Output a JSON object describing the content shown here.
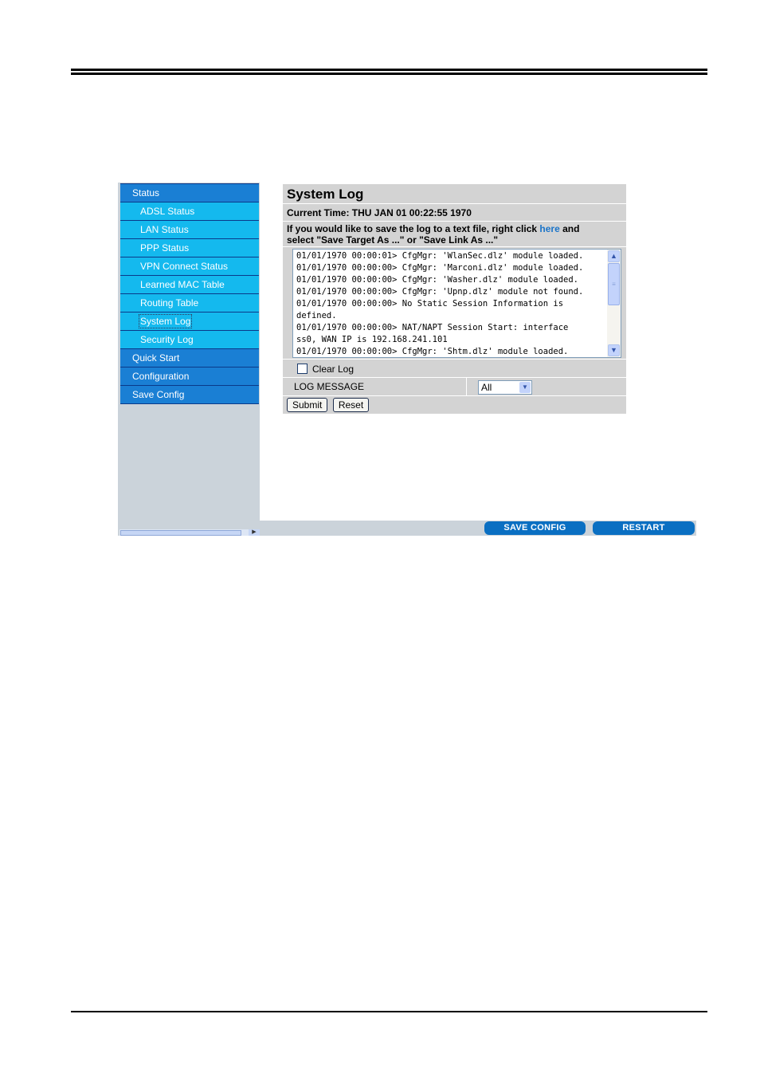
{
  "sidebar": {
    "items": [
      {
        "label": "Status",
        "level": "top"
      },
      {
        "label": "ADSL Status",
        "level": "sub"
      },
      {
        "label": "LAN Status",
        "level": "sub"
      },
      {
        "label": "PPP Status",
        "level": "sub"
      },
      {
        "label": "VPN Connect Status",
        "level": "sub"
      },
      {
        "label": "Learned MAC Table",
        "level": "sub"
      },
      {
        "label": "Routing Table",
        "level": "sub"
      },
      {
        "label": "System Log",
        "level": "sub",
        "selected": true
      },
      {
        "label": "Security Log",
        "level": "sub"
      },
      {
        "label": "Quick Start",
        "level": "top"
      },
      {
        "label": "Configuration",
        "level": "top"
      },
      {
        "label": "Save Config",
        "level": "top"
      }
    ],
    "scroll_arrow_icon": "scroll-right-icon"
  },
  "main": {
    "title": "System Log",
    "current_time": "Current Time: THU JAN 01 00:22:55 1970",
    "note_before": "If you would like to save the log to a text file, right click ",
    "note_link": "here",
    "note_after": " and",
    "note_line2": "select \"Save Target As ...\" or \"Save Link As ...\"",
    "log_lines": [
      "01/01/1970 00:00:01> CfgMgr: 'WlanSec.dlz' module loaded.",
      "01/01/1970 00:00:00> CfgMgr: 'Marconi.dlz' module loaded.",
      "01/01/1970 00:00:00> CfgMgr: 'Washer.dlz' module loaded.",
      "01/01/1970 00:00:00> CfgMgr: 'Upnp.dlz' module not found.",
      "01/01/1970 00:00:00> No Static Session Information is",
      "defined.",
      "01/01/1970 00:00:00> NAT/NAPT Session Start: interface",
      "ss0, WAN IP is 192.168.241.101",
      "01/01/1970 00:00:00> CfgMgr: 'Shtm.dlz' module loaded."
    ],
    "clear_log_label": "Clear Log",
    "clear_log_checked": false,
    "log_message_label": "LOG MESSAGE",
    "log_message_value": "All",
    "submit_label": "Submit",
    "reset_label": "Reset"
  },
  "footer": {
    "save_config_label": "SAVE CONFIG",
    "restart_label": "RESTART"
  },
  "colors": {
    "menu_top": "#1a7fd4",
    "menu_sub": "#14b9ee",
    "panel_bg": "#d3d3d3",
    "link": "#1a74c9",
    "action_button": "#0a6fc2"
  }
}
